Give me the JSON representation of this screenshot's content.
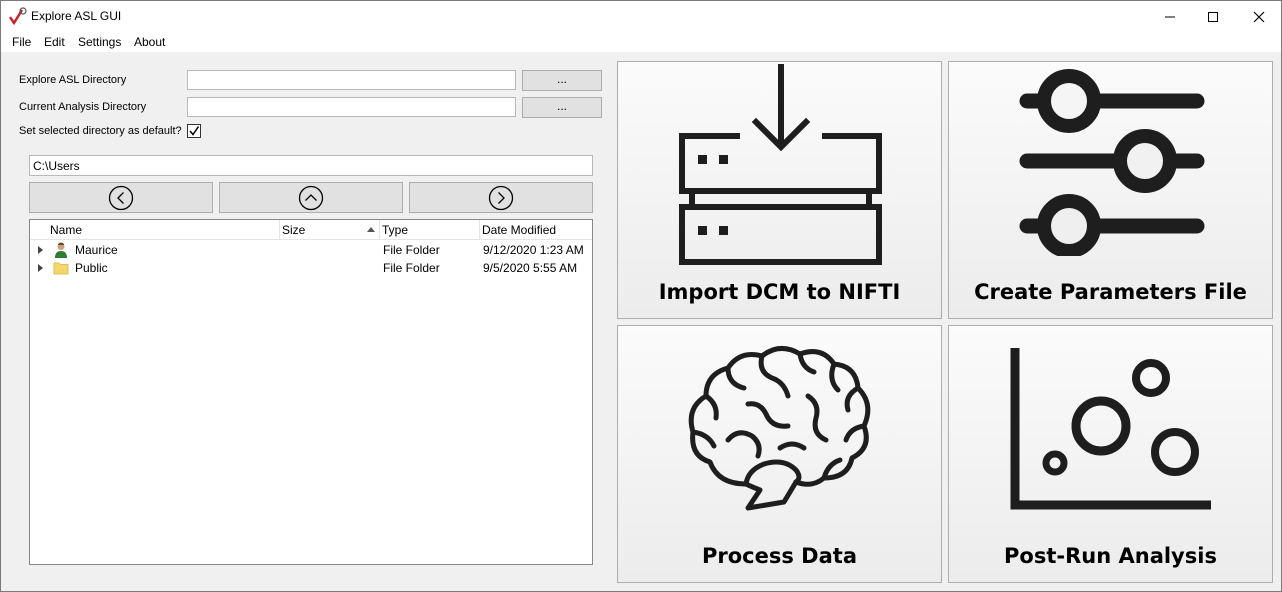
{
  "window": {
    "title": "Explore ASL GUI"
  },
  "menu": [
    {
      "label": "File"
    },
    {
      "label": "Edit"
    },
    {
      "label": "Settings"
    },
    {
      "label": "About"
    }
  ],
  "form": {
    "explore_asl_label": "Explore ASL Directory",
    "explore_asl_value": "",
    "analysis_label": "Current Analysis Directory",
    "analysis_value": "",
    "browse_label": "...",
    "default_label": "Set selected directory as default?",
    "default_checked": true
  },
  "browser": {
    "path": "C:\\Users",
    "columns": [
      "Name",
      "Size",
      "Type",
      "Date Modified"
    ],
    "sort_column": "Size",
    "rows": [
      {
        "name": "Maurice",
        "size": "",
        "type": "File Folder",
        "modified": "9/12/2020 1:23 AM",
        "icon": "user-folder-icon"
      },
      {
        "name": "Public",
        "size": "",
        "type": "File Folder",
        "modified": "9/5/2020 5:55 AM",
        "icon": "folder-icon"
      }
    ]
  },
  "tiles": {
    "import": "Import DCM to NIFTI",
    "params": "Create Parameters File",
    "process": "Process Data",
    "post": "Post-Run Analysis"
  }
}
